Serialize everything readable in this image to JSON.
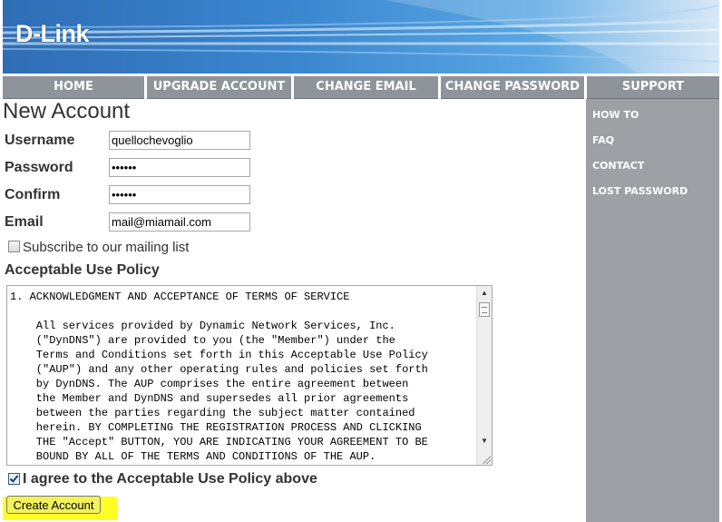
{
  "header": {
    "logo": "D-Link"
  },
  "nav": {
    "items": [
      "HOME",
      "UPGRADE ACCOUNT",
      "CHANGE EMAIL",
      "CHANGE PASSWORD",
      "SUPPORT"
    ]
  },
  "sidebar": {
    "links": [
      "HOW TO",
      "FAQ",
      "CONTACT",
      "LOST PASSWORD"
    ]
  },
  "form": {
    "title": "New Account",
    "username_label": "Username",
    "username_value": "quellochevoglio",
    "password_label": "Password",
    "password_value": "••••••",
    "confirm_label": "Confirm",
    "confirm_value": "••••••",
    "email_label": "Email",
    "email_value": "mail@miamail.com",
    "subscribe_label": "Subscribe to our mailing list",
    "subscribe_checked": false,
    "aup_heading": "Acceptable Use Policy",
    "aup_text": "1. ACKNOWLEDGMENT AND ACCEPTANCE OF TERMS OF SERVICE\n\n    All services provided by Dynamic Network Services, Inc.\n    (\"DynDNS\") are provided to you (the \"Member\") under the\n    Terms and Conditions set forth in this Acceptable Use Policy\n    (\"AUP\") and any other operating rules and policies set forth\n    by DynDNS. The AUP comprises the entire agreement between\n    the Member and DynDNS and supersedes all prior agreements\n    between the parties regarding the subject matter contained\n    herein. BY COMPLETING THE REGISTRATION PROCESS AND CLICKING\n    THE \"Accept\" BUTTON, YOU ARE INDICATING YOUR AGREEMENT TO BE\n    BOUND BY ALL OF THE TERMS AND CONDITIONS OF THE AUP.",
    "agree_label": "I agree to the Acceptable Use Policy above",
    "agree_checked": true,
    "submit_label": "Create Account"
  },
  "colors": {
    "nav_bg": "#8f949a",
    "sidebar_bg": "#9da1a6",
    "banner_blue": "#3a86cf",
    "button_highlight": "#f2f25a"
  },
  "icons": {
    "scroll_up": "triangle-up-icon",
    "scroll_down": "triangle-down-icon"
  }
}
